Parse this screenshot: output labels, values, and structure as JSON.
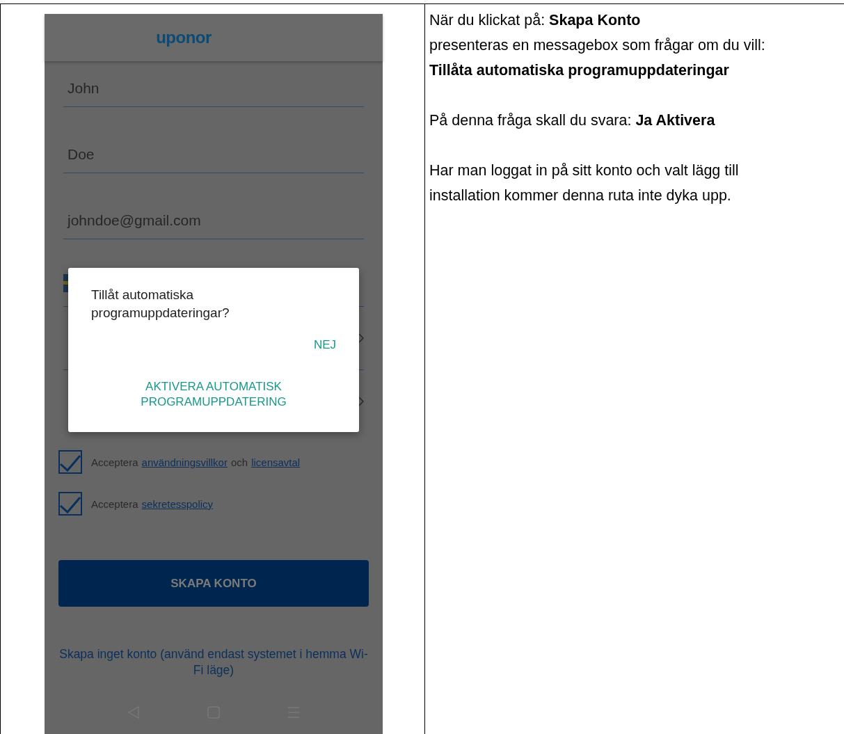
{
  "phone": {
    "logo": "uponor",
    "fields": [
      {
        "value": "John"
      },
      {
        "value": "Doe"
      },
      {
        "value": "johndoe@gmail.com"
      }
    ],
    "checkboxes": [
      {
        "checked": true,
        "segments": [
          {
            "kind": "text",
            "text": "Acceptera"
          },
          {
            "kind": "link",
            "text": "användningsvillkor"
          },
          {
            "kind": "text",
            "text": "och"
          },
          {
            "kind": "link",
            "text": "licensavtal"
          }
        ]
      },
      {
        "checked": true,
        "segments": [
          {
            "kind": "text",
            "text": "Acceptera"
          },
          {
            "kind": "link",
            "text": "sekretesspolicy"
          }
        ]
      }
    ],
    "button": "SKAPA KONTO",
    "skip_link": "Skapa inget konto (använd endast systemet i hemma Wi-Fi läge)",
    "dialog": {
      "message": "Tillåt automatiska programuppdateringar?",
      "buttons": [
        {
          "label": "NEJ",
          "kind": "inline"
        },
        {
          "label": "AKTIVERA AUTOMATISK PROGRAMUPPDATERING",
          "kind": "stacked"
        }
      ]
    }
  },
  "instruction": {
    "paragraphs": [
      [
        "När du klickat på: **Skapa Konto**",
        "presenteras en messagebox som frågar om du vill:",
        "**Tillåta automatiska programuppdateringar**"
      ],
      [
        "På denna fråga skall du svara: **Ja Aktivera**"
      ],
      [
        "Har man loggat in på sitt konto och valt lägg till",
        "installation kommer denna ruta inte dyka upp."
      ]
    ]
  }
}
